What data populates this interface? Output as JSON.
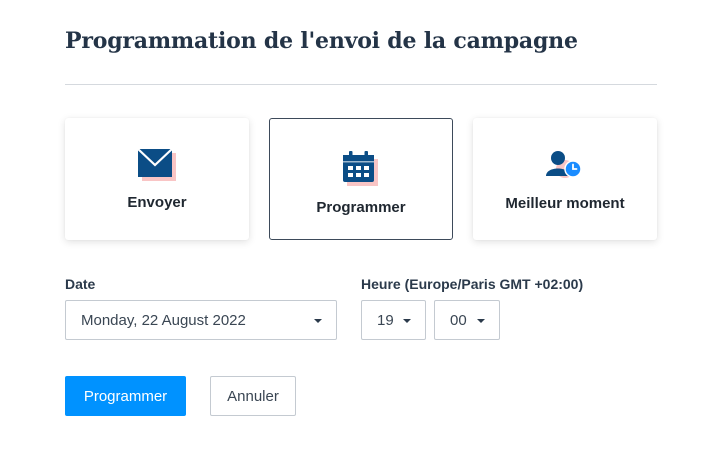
{
  "header": {
    "title": "Programmation de l'envoi de la campagne"
  },
  "options": [
    {
      "label": "Envoyer",
      "icon": "envelope-icon",
      "selected": false
    },
    {
      "label": "Programmer",
      "icon": "calendar-icon",
      "selected": true
    },
    {
      "label": "Meilleur moment",
      "icon": "user-clock-icon",
      "selected": false
    }
  ],
  "date": {
    "label": "Date",
    "value": "Monday, 22 August 2022"
  },
  "time": {
    "label": "Heure (Europe/Paris GMT +02:00)",
    "hour": "19",
    "minute": "00"
  },
  "actions": {
    "submit_label": "Programmer",
    "cancel_label": "Annuler"
  },
  "colors": {
    "primary": "#0092ff",
    "icon_dark": "#0b4d86",
    "icon_shadow": "#f9c5c5",
    "clock_blue": "#1a8cff"
  }
}
